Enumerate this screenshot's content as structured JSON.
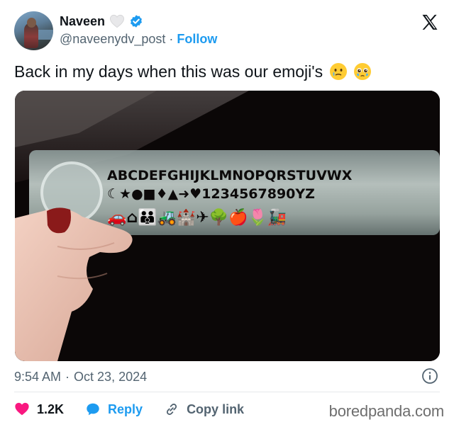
{
  "user": {
    "name": "Naveen",
    "handle": "@naveenydv_post",
    "separator": "·",
    "follow_label": "Follow"
  },
  "tweet": {
    "text": "Back in my days when this was our emoji's",
    "emojis": [
      "crying-face-emoji",
      "pleading-face-emoji"
    ]
  },
  "media": {
    "stencil_rows": [
      "ABCDEFGHIJKLMNOPQRSTUVWX",
      "☾★●■♦▲➜♥1234567890YZ",
      "🚗⌂👪🚜🏰✈🌳🍎🌷🚂"
    ]
  },
  "meta": {
    "time": "9:54 AM",
    "separator": "·",
    "date": "Oct 23, 2024"
  },
  "actions": {
    "like_count": "1.2K",
    "reply_label": "Reply",
    "copy_label": "Copy link"
  },
  "watermark": "boredpanda.com",
  "colors": {
    "accent": "#1d9bf0",
    "like": "#f91880",
    "secondary_text": "#536471"
  },
  "icons": [
    "verified-icon",
    "heart-outline-icon",
    "x-logo-icon",
    "info-icon",
    "heart-icon",
    "reply-bubble-icon",
    "link-icon"
  ]
}
